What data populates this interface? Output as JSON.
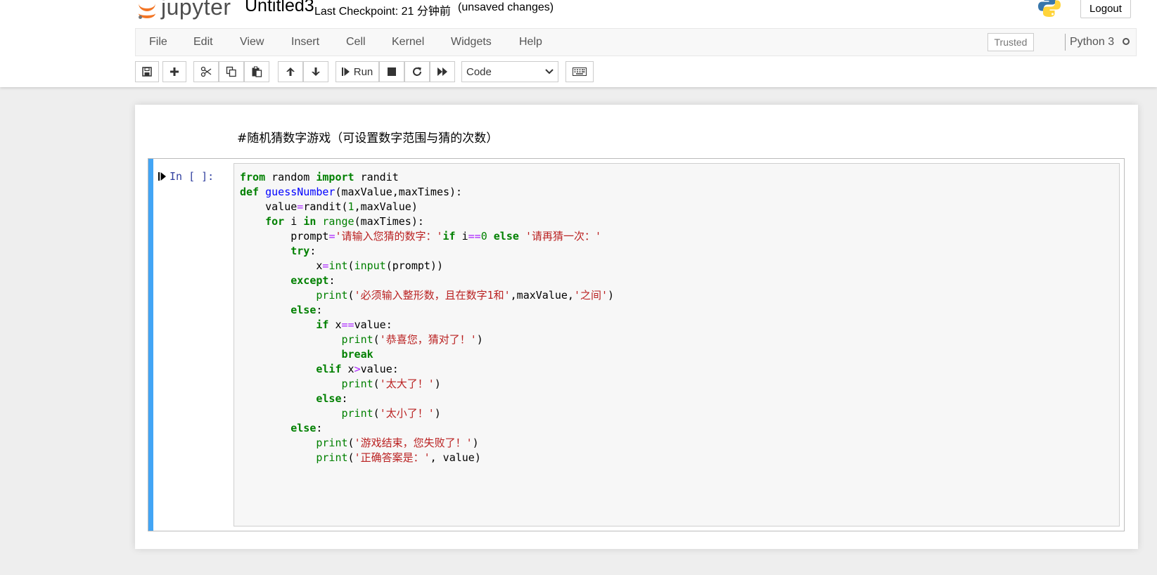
{
  "header": {
    "logo_text": "jupyter",
    "notebook_name": "Untitled3",
    "checkpoint": "Last Checkpoint: 21 分钟前",
    "autosave_status": "(unsaved changes)",
    "logout_label": "Logout"
  },
  "menubar": {
    "items": [
      "File",
      "Edit",
      "View",
      "Insert",
      "Cell",
      "Kernel",
      "Widgets",
      "Help"
    ],
    "trusted_label": "Trusted",
    "kernel_name": "Python 3"
  },
  "toolbar": {
    "buttons": [
      "save-icon",
      "plus-icon",
      "cut-icon",
      "copy-icon",
      "paste-icon",
      "arrow-up-icon",
      "arrow-down-icon",
      "run-icon",
      "stop-icon",
      "restart-icon",
      "fast-forward-icon",
      "keyboard-icon"
    ],
    "run_label": "Run",
    "cell_type": "Code"
  },
  "notebook": {
    "markdown_text": "#随机猜数字游戏（可设置数字范围与猜的次数）",
    "code_cell": {
      "prompt": "In [ ]:",
      "lines": [
        [
          [
            "kw",
            "from"
          ],
          [
            "plain",
            " random "
          ],
          [
            "kw",
            "import"
          ],
          [
            "plain",
            " randit"
          ]
        ],
        [
          [
            "kw",
            "def"
          ],
          [
            "plain",
            " "
          ],
          [
            "def",
            "guessNumber"
          ],
          [
            "plain",
            "(maxValue,maxTimes):"
          ]
        ],
        [
          [
            "plain",
            "    value"
          ],
          [
            "op",
            "="
          ],
          [
            "plain",
            "randit("
          ],
          [
            "num",
            "1"
          ],
          [
            "plain",
            ",maxValue)"
          ]
        ],
        [
          [
            "plain",
            "    "
          ],
          [
            "kw",
            "for"
          ],
          [
            "plain",
            " i "
          ],
          [
            "kw",
            "in"
          ],
          [
            "plain",
            " "
          ],
          [
            "builtin",
            "range"
          ],
          [
            "plain",
            "(maxTimes):"
          ]
        ],
        [
          [
            "plain",
            "        prompt"
          ],
          [
            "op",
            "="
          ],
          [
            "str",
            "'请输入您猜的数字：'"
          ],
          [
            "kw",
            "if"
          ],
          [
            "plain",
            " i"
          ],
          [
            "op",
            "=="
          ],
          [
            "num",
            "0"
          ],
          [
            "plain",
            " "
          ],
          [
            "kw",
            "else"
          ],
          [
            "plain",
            " "
          ],
          [
            "str",
            "'请再猜一次：'"
          ]
        ],
        [
          [
            "plain",
            "        "
          ],
          [
            "kw",
            "try"
          ],
          [
            "plain",
            ":"
          ]
        ],
        [
          [
            "plain",
            "            x"
          ],
          [
            "op",
            "="
          ],
          [
            "builtin",
            "int"
          ],
          [
            "plain",
            "("
          ],
          [
            "builtin",
            "input"
          ],
          [
            "plain",
            "(prompt))"
          ]
        ],
        [
          [
            "plain",
            "        "
          ],
          [
            "kw",
            "except"
          ],
          [
            "plain",
            ":"
          ]
        ],
        [
          [
            "plain",
            "            "
          ],
          [
            "builtin",
            "print"
          ],
          [
            "plain",
            "("
          ],
          [
            "str",
            "'必须输入整形数，且在数字1和'"
          ],
          [
            "plain",
            ",maxValue,"
          ],
          [
            "str",
            "'之间'"
          ],
          [
            "plain",
            ")"
          ]
        ],
        [
          [
            "plain",
            "        "
          ],
          [
            "kw",
            "else"
          ],
          [
            "plain",
            ":"
          ]
        ],
        [
          [
            "plain",
            "            "
          ],
          [
            "kw",
            "if"
          ],
          [
            "plain",
            " x"
          ],
          [
            "op",
            "=="
          ],
          [
            "plain",
            "value:"
          ]
        ],
        [
          [
            "plain",
            "                "
          ],
          [
            "builtin",
            "print"
          ],
          [
            "plain",
            "("
          ],
          [
            "str",
            "'恭喜您，猜对了！'"
          ],
          [
            "plain",
            ")"
          ]
        ],
        [
          [
            "plain",
            "                "
          ],
          [
            "kw",
            "break"
          ]
        ],
        [
          [
            "plain",
            "            "
          ],
          [
            "kw",
            "elif"
          ],
          [
            "plain",
            " x"
          ],
          [
            "op",
            ">"
          ],
          [
            "plain",
            "value:"
          ]
        ],
        [
          [
            "plain",
            "                "
          ],
          [
            "builtin",
            "print"
          ],
          [
            "plain",
            "("
          ],
          [
            "str",
            "'太大了！'"
          ],
          [
            "plain",
            ")"
          ]
        ],
        [
          [
            "plain",
            "            "
          ],
          [
            "kw",
            "else"
          ],
          [
            "plain",
            ":"
          ]
        ],
        [
          [
            "plain",
            "                "
          ],
          [
            "builtin",
            "print"
          ],
          [
            "plain",
            "("
          ],
          [
            "str",
            "'太小了！'"
          ],
          [
            "plain",
            ")"
          ]
        ],
        [
          [
            "plain",
            "        "
          ],
          [
            "kw",
            "else"
          ],
          [
            "plain",
            ":"
          ]
        ],
        [
          [
            "plain",
            "            "
          ],
          [
            "builtin",
            "print"
          ],
          [
            "plain",
            "("
          ],
          [
            "str",
            "'游戏结束，您失败了！'"
          ],
          [
            "plain",
            ")"
          ]
        ],
        [
          [
            "plain",
            "            "
          ],
          [
            "builtin",
            "print"
          ],
          [
            "plain",
            "("
          ],
          [
            "str",
            "'正确答案是：'"
          ],
          [
            "plain",
            ", value)"
          ]
        ]
      ]
    }
  },
  "colors": {
    "accent": "#42a5f5",
    "keyword": "#008000",
    "string": "#ba2121",
    "operator": "#aa22ff",
    "function_def": "#0000ff",
    "logo_orange": "#f37626"
  }
}
